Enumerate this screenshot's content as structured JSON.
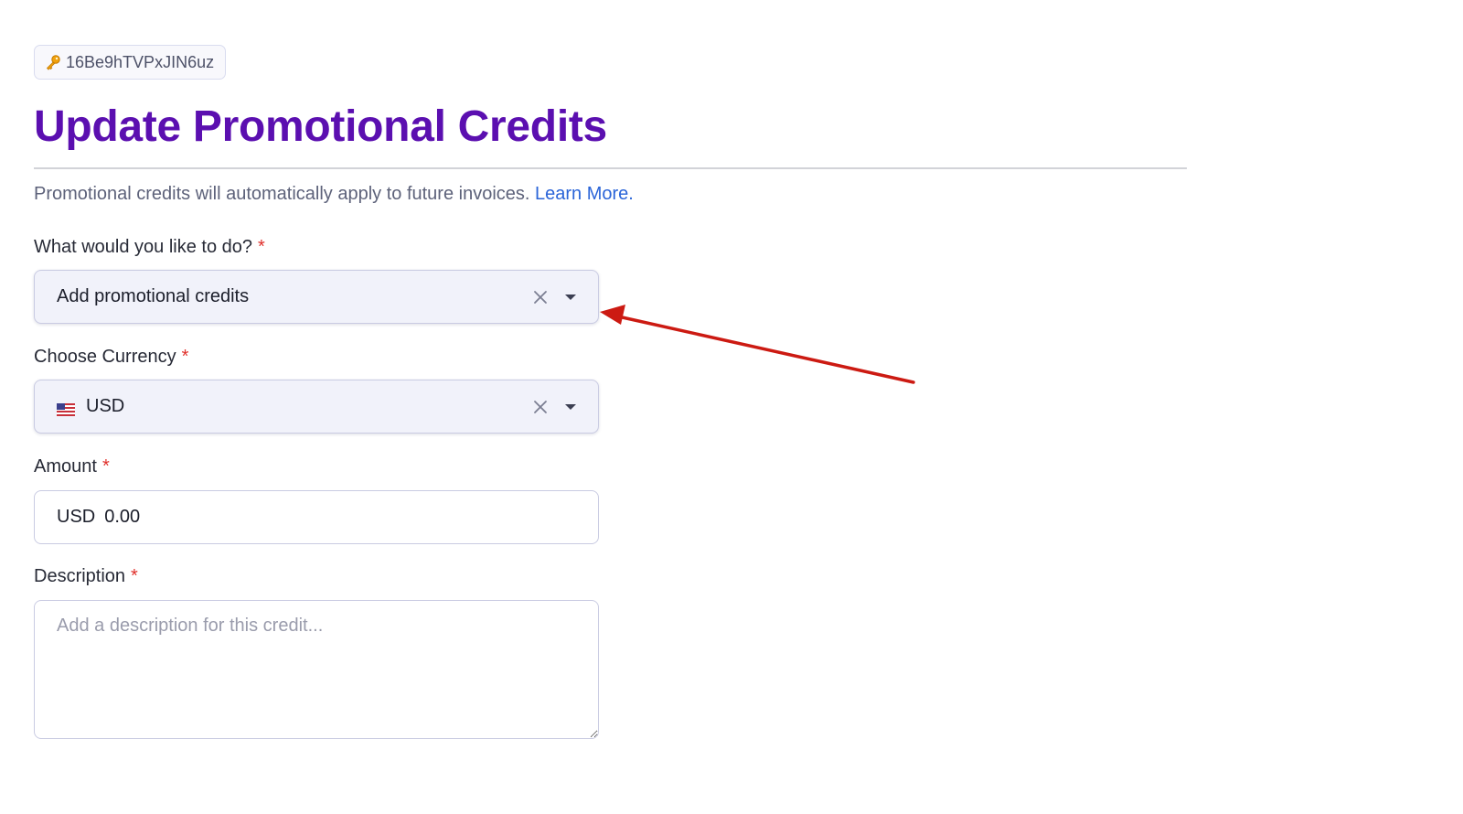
{
  "resource_id": {
    "icon": "key-icon",
    "text": "16Be9hTVPxJIN6uz"
  },
  "header": {
    "title": "Update Promotional Credits"
  },
  "intro": {
    "text": "Promotional credits will automatically apply to future invoices.",
    "link_label": "Learn More."
  },
  "form": {
    "required_marker": "*",
    "action": {
      "label": "What would you like to do?",
      "selected": "Add promotional credits"
    },
    "currency": {
      "label": "Choose Currency",
      "selected": "USD",
      "flag_icon": "us-flag-icon"
    },
    "amount": {
      "label": "Amount",
      "prefix": "USD",
      "value": "0.00"
    },
    "description": {
      "label": "Description",
      "placeholder": "Add a description for this credit..."
    }
  },
  "colors": {
    "title": "#5b0fb0",
    "link": "#2a64d8",
    "required": "#e0302b",
    "annotation_arrow": "#cc1a12"
  }
}
